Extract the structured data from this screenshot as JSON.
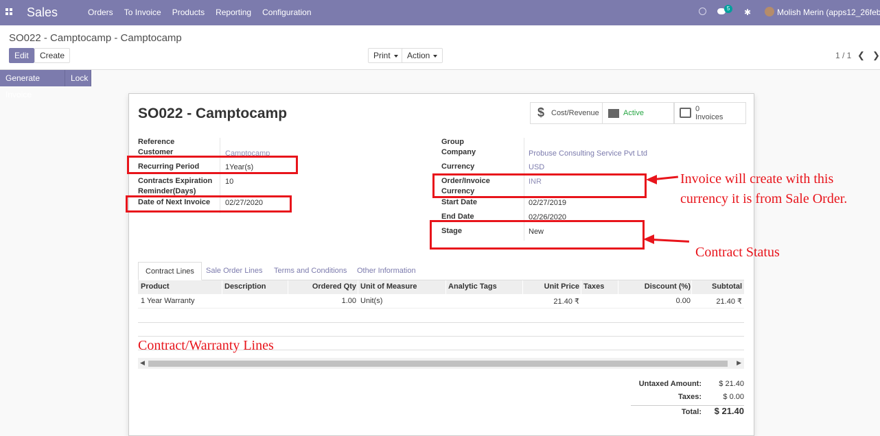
{
  "navbar": {
    "brand": "Sales",
    "menu": [
      "Orders",
      "To Invoice",
      "Products",
      "Reporting",
      "Configuration"
    ],
    "chat_count": "5",
    "user": "Molish Merin (apps12_26feb19)"
  },
  "control_panel": {
    "breadcrumb": "SO022 - Camptocamp - Camptocamp",
    "edit": "Edit",
    "create": "Create",
    "print": "Print",
    "action": "Action",
    "pager": "1 / 1"
  },
  "statusbar": {
    "generate_invoice": "Generate Invoice",
    "lock": "Lock"
  },
  "record": {
    "title": "SO022 - Camptocamp",
    "smart_buttons": {
      "cost_revenue": "Cost/Revenue",
      "active": "Active",
      "invoices_count": "0",
      "invoices": "Invoices"
    },
    "left": {
      "reference_label": "Reference",
      "customer_label": "Customer",
      "customer_value": "Camptocamp",
      "recurring_period_label": "Recurring Period",
      "recurring_period_value": "1Year(s)",
      "contracts_expiration_label_1": "Contracts Expiration",
      "contracts_expiration_label_2": "Reminder(Days)",
      "contracts_expiration_value": "10",
      "next_invoice_label": "Date of Next Invoice",
      "next_invoice_value": "02/27/2020"
    },
    "right": {
      "group_label": "Group",
      "company_label": "Company",
      "company_value": "Probuse Consulting Service Pvt Ltd",
      "currency_label": "Currency",
      "currency_value": "USD",
      "order_currency_label_1": "Order/Invoice",
      "order_currency_label_2": "Currency",
      "order_currency_value": "INR",
      "start_date_label": "Start Date",
      "start_date_value": "02/27/2019",
      "end_date_label": "End Date",
      "end_date_value": "02/26/2020",
      "stage_label": "Stage",
      "stage_value": "New"
    }
  },
  "tabs": [
    "Contract Lines",
    "Sale Order Lines",
    "Terms and Conditions",
    "Other Information"
  ],
  "lines": {
    "columns": [
      "Product",
      "Description",
      "Ordered Qty",
      "Unit of Measure",
      "Analytic Tags",
      "Unit Price",
      "Taxes",
      "Discount (%)",
      "Subtotal"
    ],
    "rows": [
      {
        "product": "1 Year Warranty",
        "description": "",
        "qty": "1.00",
        "uom": "Unit(s)",
        "tags": "",
        "price": "21.40 ₹",
        "taxes": "",
        "discount": "0.00",
        "subtotal": "21.40 ₹"
      }
    ]
  },
  "totals": {
    "untaxed_label": "Untaxed Amount:",
    "untaxed_value": "$ 21.40",
    "taxes_label": "Taxes:",
    "taxes_value": "$ 0.00",
    "total_label": "Total:",
    "total_value": "$ 21.40"
  },
  "annotations": {
    "currency_1": "Invoice will create with this",
    "currency_2": "currency it is from Sale Order.",
    "status": "Contract Status",
    "lines": "Contract/Warranty Lines"
  },
  "colors": {
    "brand": "#7c7bad",
    "annotation_red": "#e8141b",
    "active_green": "#28a745"
  }
}
